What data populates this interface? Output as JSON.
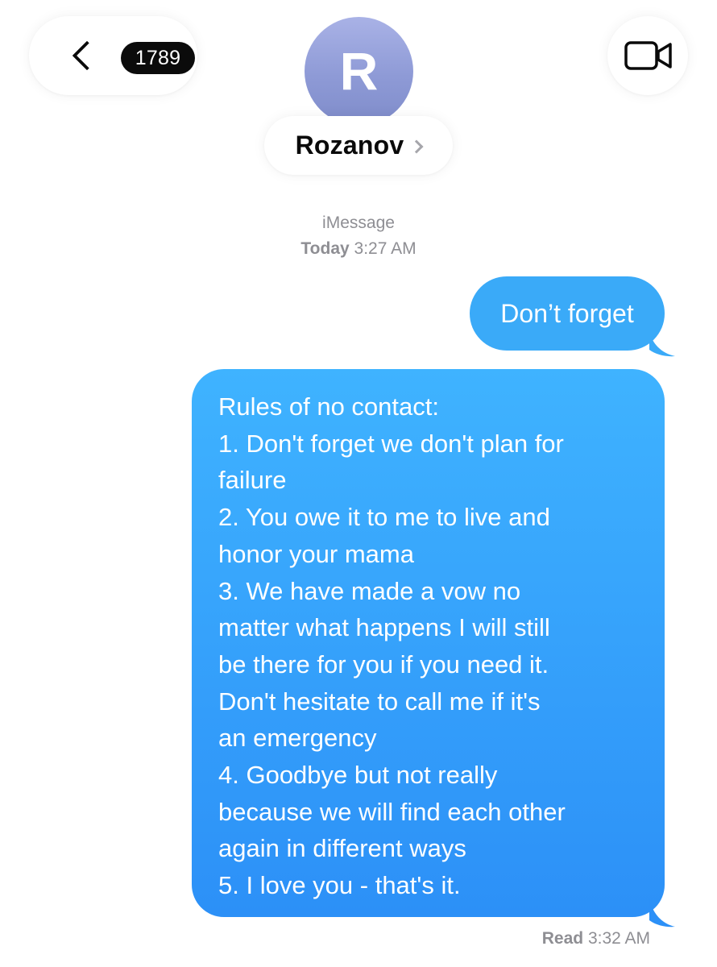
{
  "header": {
    "unread_count": "1789",
    "contact_initial": "R",
    "contact_name": "Rozanov"
  },
  "meta": {
    "service": "iMessage",
    "day": "Today",
    "time": "3:27 AM"
  },
  "messages": [
    {
      "text": "Don’t forget"
    },
    {
      "lines": [
        "Rules of no contact:",
        "1. Don't forget we don't plan for",
        "failure",
        "2. You owe it to me to live and",
        "honor your mama",
        "3. We have made a vow no",
        "matter what happens I will still",
        "be there for you if you need it.",
        "Don't hesitate to call me if it's",
        "an emergency",
        "4. Goodbye but not really",
        "because we will find each other",
        "again in different ways",
        "5. I love you - that's it."
      ]
    }
  ],
  "receipt": {
    "status": "Read",
    "time": "3:32 AM"
  },
  "colors": {
    "bubble_blue": "#3aaaf8",
    "meta_gray": "#8e8e93",
    "avatar_purple": "#8e9ad6"
  },
  "icons": {
    "back": "chevron-left-icon",
    "video": "video-camera-icon",
    "name_disclosure": "chevron-right-icon"
  }
}
